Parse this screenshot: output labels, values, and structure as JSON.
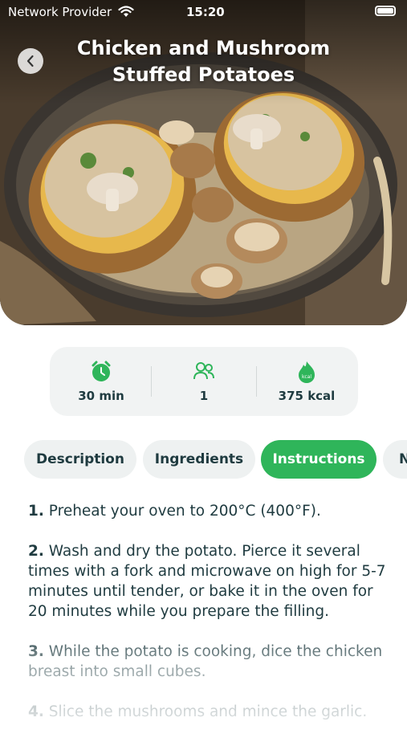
{
  "status_bar": {
    "carrier": "Network Provider",
    "time": "15:20"
  },
  "recipe": {
    "title_line1": "Chicken and Mushroom",
    "title_line2": "Stuffed Potatoes"
  },
  "stats": {
    "time": "30 min",
    "servings": "1",
    "calories": "375 kcal",
    "calorie_icon_text": "kcal"
  },
  "tabs": [
    {
      "label": "Description",
      "active": false
    },
    {
      "label": "Ingredients",
      "active": false
    },
    {
      "label": "Instructions",
      "active": true
    },
    {
      "label": "N",
      "active": false
    }
  ],
  "instructions": [
    {
      "num": "1.",
      "text": " Preheat your oven to 200°C (400°F)."
    },
    {
      "num": "2.",
      "text": " Wash and dry the potato. Pierce it several times with a fork and microwave on high for 5-7 minutes until tender, or bake it in the oven for 20 minutes while you prepare the filling."
    },
    {
      "num": "3.",
      "text": " While the potato is cooking, dice the chicken breast into small cubes."
    },
    {
      "num": "4.",
      "text": " Slice the mushrooms and mince the garlic."
    }
  ],
  "colors": {
    "accent": "#2fb55a",
    "text": "#1f3b40",
    "card_bg": "#f1f3f3"
  },
  "icons": [
    "back-chevron-icon",
    "alarm-clock-icon",
    "people-icon",
    "calorie-flame-icon",
    "wifi-icon",
    "battery-icon"
  ]
}
